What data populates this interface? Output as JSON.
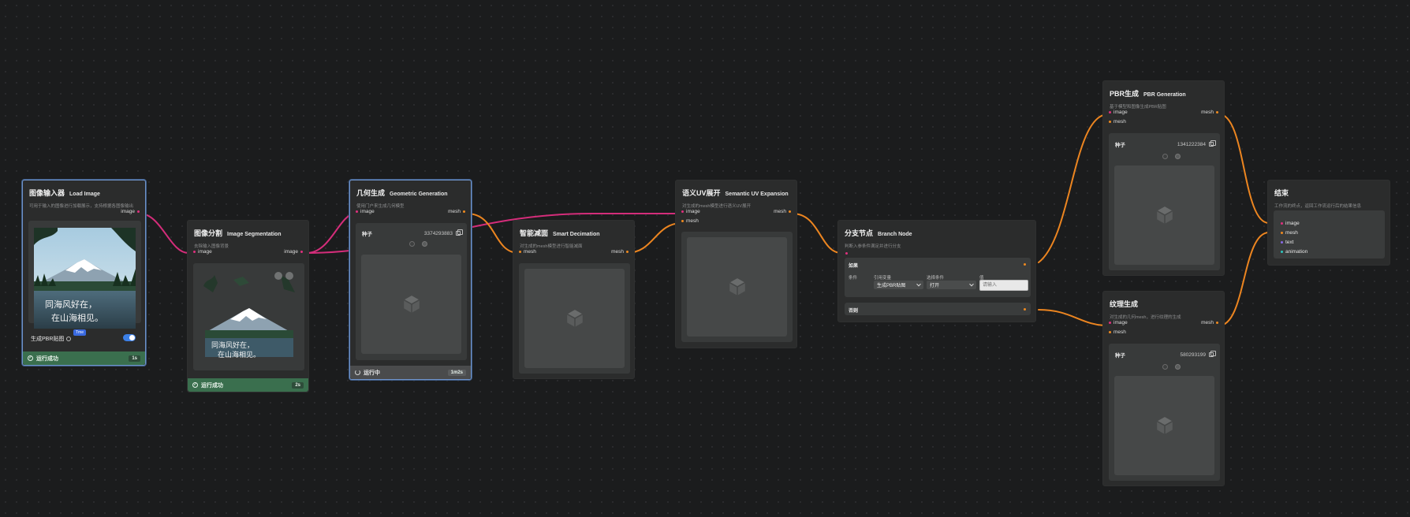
{
  "cube_icon": "cube-icon",
  "nodes": {
    "load_image": {
      "title_zh": "图像输入器",
      "title_en": "Load Image",
      "desc": "可用于输入的图像进行加载展示，支持根据各图像输出",
      "out_port": "image",
      "pbr_label": "生成PBR贴图",
      "pbr_toggle": true,
      "tip": "Tme",
      "status": "运行成功",
      "time": "1s",
      "image_text_1": "同海风好在，",
      "image_text_2": "在山海相见。"
    },
    "segmentation": {
      "title_zh": "图像分割",
      "title_en": "Image Segmentation",
      "desc": "去除输入图像背景",
      "in_port": "image",
      "out_port": "image",
      "status": "运行成功",
      "time": "2s",
      "image_text_1": "同海风好在，",
      "image_text_2": "在山海相见。"
    },
    "geometric": {
      "title_zh": "几何生成",
      "title_en": "Geometric Generation",
      "desc": "使用门户来生成几何模型",
      "in_port": "image",
      "out_port": "mesh",
      "seed_label": "种子",
      "seed_value": "3374293883",
      "status": "运行中",
      "time": "1m2s"
    },
    "decimation": {
      "title_zh": "智能减面",
      "title_en": "Smart Decimation",
      "desc": "对生成的mesh模型进行智能减面",
      "in_port": "mesh",
      "out_port": "mesh"
    },
    "uv": {
      "title_zh": "语义UV展开",
      "title_en": "Semantic UV Expansion",
      "desc": "对生成的mesh模型进行语义UV展开",
      "in_ports": [
        "image",
        "mesh"
      ],
      "out_port": "mesh"
    },
    "branch": {
      "title_zh": "分支节点",
      "title_en": "Branch Node",
      "desc": "判断入参条件满足并进行分支",
      "if_label": "如果",
      "cond_label": "条件",
      "ref_label": "引用变量",
      "ref_value": "生成PBR贴图",
      "choose_label": "选择条件",
      "choose_value": "打开",
      "value_label": "值",
      "value_placeholder": "请输入",
      "else_label": "否则"
    },
    "pbr": {
      "title_zh": "PBR生成",
      "title_en": "PBR Generation",
      "desc": "基于模型和图像生成PBR贴图",
      "in_ports": [
        "image",
        "mesh"
      ],
      "out_port": "mesh",
      "seed_label": "种子",
      "seed_value": "1341222384"
    },
    "texture": {
      "title_zh": "纹理生成",
      "title_en": "",
      "desc": "对生成的几何mesh，进行纹理的生成",
      "in_ports": [
        "image",
        "mesh"
      ],
      "out_port": "mesh",
      "seed_label": "种子",
      "seed_value": "580293199"
    },
    "end": {
      "title_zh": "结束",
      "desc": "工作流的终点，返回工作流运行后的结果信息",
      "outputs": [
        "image",
        "mesh",
        "text",
        "animation"
      ]
    }
  },
  "colors": {
    "image_wire": "#d42d7a",
    "mesh_wire": "#ec8520",
    "success": "#3a6f4e",
    "selected_border": "#6f93c9"
  }
}
